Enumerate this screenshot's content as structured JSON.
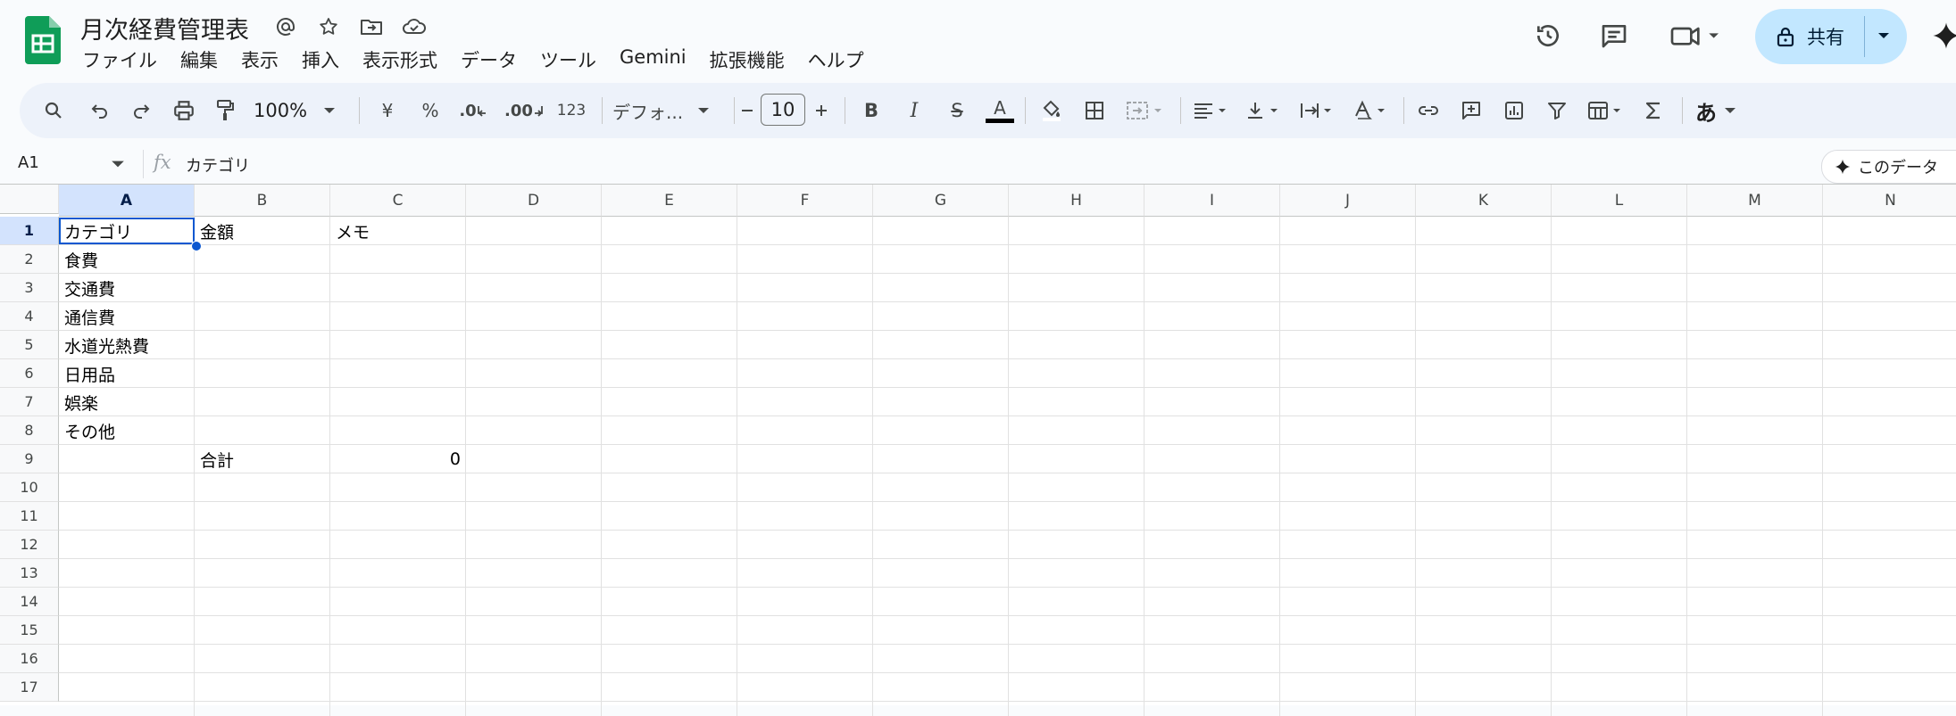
{
  "app": {
    "doc_title": "月次経費管理表",
    "menus": [
      "ファイル",
      "編集",
      "表示",
      "挿入",
      "表示形式",
      "データ",
      "ツール",
      "Gemini",
      "拡張機能",
      "ヘルプ"
    ],
    "share_label": "共有"
  },
  "toolbar": {
    "zoom": "100%",
    "currency": "¥",
    "percent": "%",
    "dec_decrease": ".0",
    "dec_increase": ".00",
    "number_format": "123",
    "font": "デフォ...",
    "font_size": "10",
    "bold": "B",
    "italic": "I",
    "strikethrough": "S",
    "text_color_letter": "A",
    "input_tools": "あ"
  },
  "formula_bar": {
    "name_box": "A1",
    "fx": "fx",
    "value": "カテゴリ",
    "explore_label": "このデータ"
  },
  "sheet": {
    "columns": [
      "A",
      "B",
      "C",
      "D",
      "E",
      "F",
      "G",
      "H",
      "I",
      "J",
      "K",
      "L",
      "M",
      "N"
    ],
    "rows": [
      "1",
      "2",
      "3",
      "4",
      "5",
      "6",
      "7",
      "8",
      "9",
      "10",
      "11",
      "12",
      "13",
      "14",
      "15",
      "16",
      "17"
    ],
    "selected_cell": "A1",
    "cells": {
      "A1": "カテゴリ",
      "B1": "金額",
      "C1": "メモ",
      "A2": "食費",
      "A3": "交通費",
      "A4": "通信費",
      "A5": "水道光熱費",
      "A6": "日用品",
      "A7": "娯楽",
      "A8": "その他",
      "B9": "合計",
      "C9": "0"
    }
  },
  "colors": {
    "accent": "#0b57d0",
    "share_bg": "#c2e7ff",
    "sheets_green": "#0f9d58",
    "toolbar_bg": "#edf2fa",
    "selected_header": "#d3e3fd"
  }
}
